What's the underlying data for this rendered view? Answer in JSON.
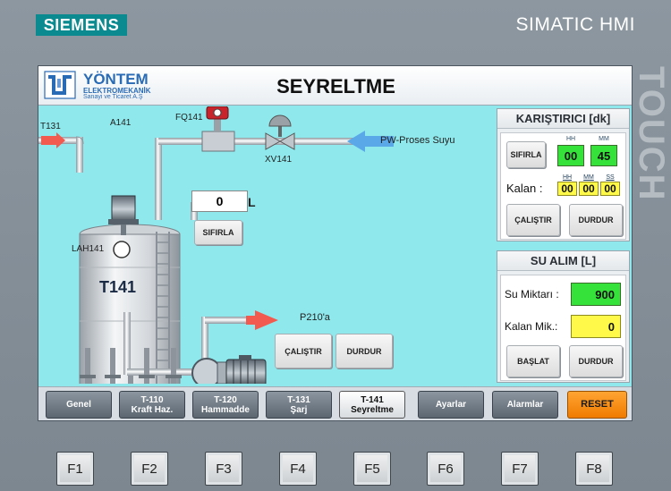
{
  "bezel": {
    "brand": "SIEMENS",
    "model": "SIMATIC HMI",
    "side_label": "TOUCH"
  },
  "header": {
    "company_name": "YÖNTEM",
    "company_line1": "ELEKTROMEKANİK",
    "company_line2": "Sanayi ve Ticaret A.Ş",
    "title": "SEYRELTME"
  },
  "process": {
    "inlet_tag": "T131",
    "mixer_tag": "A141",
    "flowmeter_tag": "FQ141",
    "valve_tag": "XV141",
    "level_tag": "LAH141",
    "tank_tag": "T141",
    "supply_label": "PW-Proses Suyu",
    "outlet_label": "P210'a",
    "flow_value": "0",
    "flow_unit": "L",
    "flow_reset_label": "SIFIRLA",
    "pump_start_label": "ÇALIŞTIR",
    "pump_stop_label": "DURDUR"
  },
  "mixer_panel": {
    "title": "KARIŞTIRICI [dk]",
    "reset_label": "SIFIRLA",
    "hh_label": "HH",
    "mm_label": "MM",
    "set_hh": "00",
    "set_mm": "45",
    "remaining_label": "Kalan :",
    "rem_hh_label": "HH",
    "rem_mm_label": "MM",
    "rem_ss_label": "SS",
    "rem_hh": "00",
    "rem_mm": "00",
    "rem_ss": "00",
    "start_label": "ÇALIŞTIR",
    "stop_label": "DURDUR"
  },
  "water_panel": {
    "title": "SU ALIM [L]",
    "amount_label": "Su Miktarı :",
    "amount_value": "900",
    "remaining_label": "Kalan Mik.:",
    "remaining_value": "0",
    "start_label": "BAŞLAT",
    "stop_label": "DURDUR"
  },
  "nav": [
    {
      "line1": "Genel",
      "line2": ""
    },
    {
      "line1": "T-110",
      "line2": "Kraft Haz."
    },
    {
      "line1": "T-120",
      "line2": "Hammadde"
    },
    {
      "line1": "T-131",
      "line2": "Şarj"
    },
    {
      "line1": "T-141",
      "line2": "Seyreltme"
    },
    {
      "line1": "Ayarlar",
      "line2": ""
    },
    {
      "line1": "Alarmlar",
      "line2": ""
    },
    {
      "line1": "RESET",
      "line2": ""
    }
  ],
  "fkeys": [
    "F1",
    "F2",
    "F3",
    "F4",
    "F5",
    "F6",
    "F7",
    "F8"
  ],
  "colors": {
    "screen_bg": "#8fe8ec",
    "setpoint_green": "#35e23a",
    "remaining_yellow": "#fff94a",
    "reset_orange": "#f28a10",
    "arrow_red": "#f25a50",
    "arrow_blue": "#5aa8e8"
  }
}
